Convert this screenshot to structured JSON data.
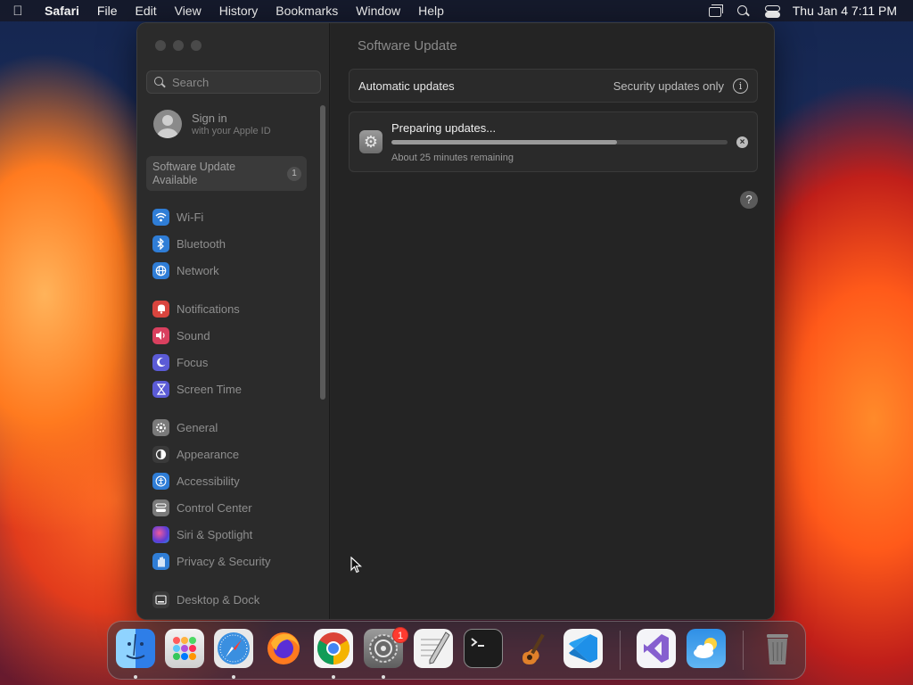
{
  "menubar": {
    "app_name": "Safari",
    "menus": [
      "File",
      "Edit",
      "View",
      "History",
      "Bookmarks",
      "Window",
      "Help"
    ],
    "clock": "Thu Jan 4  7:11 PM"
  },
  "window": {
    "sidebar": {
      "search_placeholder": "Search",
      "signin_title": "Sign in",
      "signin_subtitle": "with your Apple ID",
      "update_available_line1": "Software Update",
      "update_available_line2": "Available",
      "update_badge": "1",
      "items": [
        {
          "label": "Wi-Fi",
          "icon": "wifi-icon",
          "color": "#2f7dd6"
        },
        {
          "label": "Bluetooth",
          "icon": "bluetooth-icon",
          "color": "#2f7dd6"
        },
        {
          "label": "Network",
          "icon": "network-icon",
          "color": "#2f7dd6"
        },
        {
          "label": "Notifications",
          "icon": "notifications-icon",
          "color": "#d9453e"
        },
        {
          "label": "Sound",
          "icon": "sound-icon",
          "color": "#d9405f"
        },
        {
          "label": "Focus",
          "icon": "focus-icon",
          "color": "#5b5bd6"
        },
        {
          "label": "Screen Time",
          "icon": "screen-time-icon",
          "color": "#5b5bd6"
        },
        {
          "label": "General",
          "icon": "general-icon",
          "color": "#7a7a7a"
        },
        {
          "label": "Appearance",
          "icon": "appearance-icon",
          "color": "#3a3a3a"
        },
        {
          "label": "Accessibility",
          "icon": "accessibility-icon",
          "color": "#2f7dd6"
        },
        {
          "label": "Control Center",
          "icon": "control-center-icon",
          "color": "#7a7a7a"
        },
        {
          "label": "Siri & Spotlight",
          "icon": "siri-icon",
          "color": "#b0468f"
        },
        {
          "label": "Privacy & Security",
          "icon": "privacy-icon",
          "color": "#2f7dd6"
        },
        {
          "label": "Desktop & Dock",
          "icon": "desktop-dock-icon",
          "color": "#3a3a3a"
        }
      ]
    },
    "main": {
      "title": "Software Update",
      "auto_updates_label": "Automatic updates",
      "auto_updates_value": "Security updates only",
      "preparing_title": "Preparing updates...",
      "preparing_progress": 0.67,
      "preparing_subtitle": "About 25 minutes remaining"
    }
  },
  "dock": {
    "apps": [
      {
        "name": "finder-icon",
        "color": "#2e9cf0",
        "running": true
      },
      {
        "name": "launchpad-icon",
        "color": "#e0e0e0",
        "running": false
      },
      {
        "name": "safari-icon",
        "color": "#3a8fe0",
        "running": true
      },
      {
        "name": "firefox-icon",
        "color": "#ff6a1f",
        "running": false
      },
      {
        "name": "chrome-icon",
        "color": "#ffffff",
        "running": true
      },
      {
        "name": "system-settings-icon",
        "color": "#8a8a8a",
        "running": true,
        "badge": "1"
      },
      {
        "name": "textedit-icon",
        "color": "#f2f2f2",
        "running": false
      },
      {
        "name": "terminal-icon",
        "color": "#1c1c1c",
        "running": false
      },
      {
        "name": "garageband-icon",
        "color": "#6b4a2a",
        "running": false
      },
      {
        "name": "vscode-icon",
        "color": "#1e90e8",
        "running": false
      },
      {
        "name": "visual-studio-icon",
        "color": "#f4f4f8",
        "running": false
      },
      {
        "name": "weather-icon",
        "color": "#2f8fe6",
        "running": false
      },
      {
        "name": "trash-icon",
        "color": "#7f7f7f",
        "running": false
      }
    ]
  }
}
